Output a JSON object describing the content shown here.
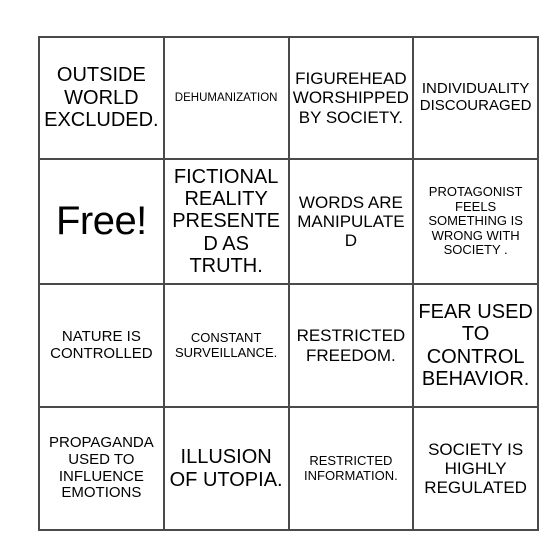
{
  "card": {
    "free_space_label": "Free!",
    "grid": [
      [
        {
          "text": "OUTSIDE WORLD EXCLUDED.",
          "size": "fs-lg"
        },
        {
          "text": "DEHUMANIZATION",
          "size": "fs-xxs"
        },
        {
          "text": "FIGUREHEAD WORSHIPPED BY SOCIETY.",
          "size": "fs-md"
        },
        {
          "text": "INDIVIDUALITY DISCOURAGED",
          "size": "fs-sm"
        }
      ],
      [
        {
          "text": "Free!",
          "size": "fs-xl"
        },
        {
          "text": "FICTIONAL REALITY PRESENTED AS TRUTH.",
          "size": "fs-lg"
        },
        {
          "text": "WORDS ARE MANIPULATED",
          "size": "fs-md"
        },
        {
          "text": "PROTAGONIST FEELS SOMETHING IS WRONG WITH SOCIETY .",
          "size": "fs-xs"
        }
      ],
      [
        {
          "text": "NATURE IS CONTROLLED",
          "size": "fs-sm"
        },
        {
          "text": "CONSTANT SURVEILLANCE.",
          "size": "fs-xs"
        },
        {
          "text": "RESTRICTED FREEDOM.",
          "size": "fs-md"
        },
        {
          "text": "FEAR USED TO CONTROL BEHAVIOR.",
          "size": "fs-lg"
        }
      ],
      [
        {
          "text": "PROPAGANDA USED TO INFLUENCE EMOTIONS",
          "size": "fs-sm"
        },
        {
          "text": "ILLUSION OF UTOPIA.",
          "size": "fs-lg"
        },
        {
          "text": "RESTRICTED INFORMATION.",
          "size": "fs-xs"
        },
        {
          "text": "SOCIETY IS HIGHLY REGULATED",
          "size": "fs-md"
        }
      ]
    ],
    "colors": {
      "background": "#ffffff",
      "border": "#4a4a4a",
      "text": "#000000"
    }
  }
}
